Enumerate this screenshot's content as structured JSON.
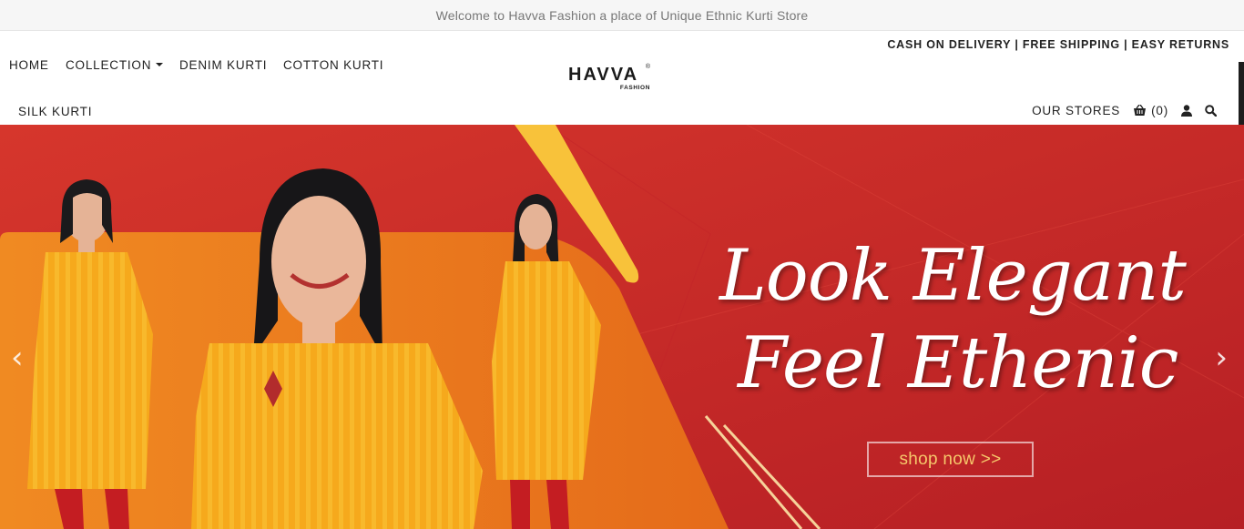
{
  "announcement": "Welcome to Havva Fashion a place of Unique Ethnic Kurti Store",
  "promo": "CASH ON DELIVERY | FREE SHIPPING | EASY RETURNS",
  "nav": {
    "home": "HOME",
    "collection": "COLLECTION",
    "denim": "DENIM KURTI",
    "cotton": "COTTON KURTI",
    "silk": "SILK KURTI"
  },
  "logo": {
    "name": "HAVVA",
    "sub": "FASHION",
    "reg": "®"
  },
  "tools": {
    "stores": "OUR STORES",
    "cart_count": "(0)"
  },
  "hero": {
    "line1": "Look Elegant",
    "line2": "Feel Ethenic",
    "cta": "shop now >>",
    "prev": "‹",
    "next": "›"
  },
  "colors": {
    "hero_red": "#c92b27",
    "hero_orange": "#ee7d1f",
    "kurti_yellow": "#f5a81c",
    "cta_text": "#f6c86b"
  }
}
